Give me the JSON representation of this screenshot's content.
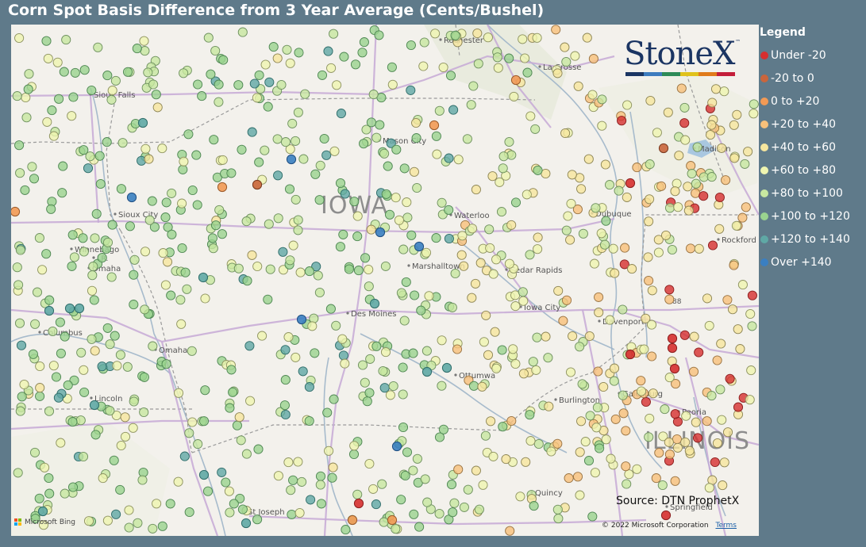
{
  "title": "Corn Spot Basis Difference from 3 Year Average (Cents/Bushel)",
  "logo": {
    "text": "StoneX",
    "tm": "™",
    "bar_colors": [
      "#1b3563",
      "#3d7cbf",
      "#2e8b57",
      "#e0c21b",
      "#e07b1b",
      "#c41e3a"
    ]
  },
  "source": "Source: DTN ProphetX",
  "map_attribution": {
    "bing": "Microsoft Bing",
    "copyright": "© 2022 Microsoft Corporation",
    "terms": "Terms"
  },
  "legend": {
    "title": "Legend",
    "items": [
      {
        "label": "Under -20",
        "color": "#d62f2f"
      },
      {
        "label": "-20 to 0",
        "color": "#c9653c"
      },
      {
        "label": "0 to +20",
        "color": "#f29a55"
      },
      {
        "label": "+20 to +40",
        "color": "#f7c07a"
      },
      {
        "label": "+40 to +60",
        "color": "#f6e69e"
      },
      {
        "label": "+60 to +80",
        "color": "#eff5b0"
      },
      {
        "label": "+80 to +100",
        "color": "#c7e7a0"
      },
      {
        "label": "+100 to +120",
        "color": "#9ad38f"
      },
      {
        "label": "+120 to +140",
        "color": "#5fa8a5"
      },
      {
        "label": "Over +140",
        "color": "#3a7fc1"
      }
    ]
  },
  "map_labels": [
    {
      "text": "Rochester",
      "kind": "city"
    },
    {
      "text": "La Crosse",
      "kind": "city"
    },
    {
      "text": "Sioux Falls",
      "kind": "city"
    },
    {
      "text": "Mason City",
      "kind": "city"
    },
    {
      "text": "Madison",
      "kind": "city"
    },
    {
      "text": "IOWA",
      "kind": "state"
    },
    {
      "text": "Sioux City",
      "kind": "city"
    },
    {
      "text": "Waterloo",
      "kind": "city"
    },
    {
      "text": "Dubuque",
      "kind": "city"
    },
    {
      "text": "Rockford",
      "kind": "city"
    },
    {
      "text": "Winnebago",
      "kind": "city"
    },
    {
      "text": "I.R.",
      "kind": "city"
    },
    {
      "text": "Omaha",
      "kind": "city"
    },
    {
      "text": "Marshalltown",
      "kind": "city"
    },
    {
      "text": "Cedar Rapids",
      "kind": "city"
    },
    {
      "text": "Iowa City",
      "kind": "city"
    },
    {
      "text": "Davenport",
      "kind": "city"
    },
    {
      "text": "Columbus",
      "kind": "city"
    },
    {
      "text": "Des Moines",
      "kind": "city"
    },
    {
      "text": "Omaha",
      "kind": "city"
    },
    {
      "text": "Ottumwa",
      "kind": "city"
    },
    {
      "text": "Galesburg",
      "kind": "city"
    },
    {
      "text": "Lincoln",
      "kind": "city"
    },
    {
      "text": "Burlington",
      "kind": "city"
    },
    {
      "text": "Peoria",
      "kind": "city"
    },
    {
      "text": "ILLINOIS",
      "kind": "state"
    },
    {
      "text": "Quincy",
      "kind": "city"
    },
    {
      "text": "St Joseph",
      "kind": "city"
    },
    {
      "text": "Springfield",
      "kind": "city"
    },
    {
      "text": "88",
      "kind": "shield"
    }
  ]
}
